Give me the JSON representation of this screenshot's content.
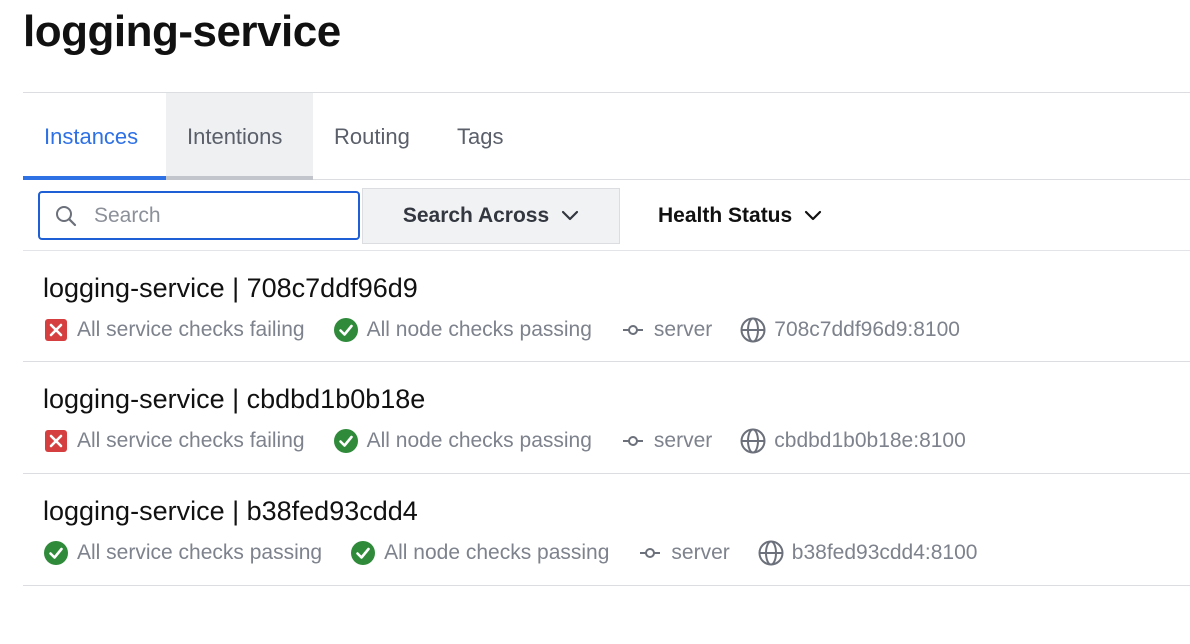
{
  "page": {
    "title": "logging-service"
  },
  "tabs": [
    {
      "label": "Instances",
      "state": "active"
    },
    {
      "label": "Intentions",
      "state": "hover"
    },
    {
      "label": "Routing",
      "state": "normal"
    },
    {
      "label": "Tags",
      "state": "normal"
    }
  ],
  "toolbar": {
    "search_placeholder": "Search",
    "search_value": "",
    "search_across_label": "Search Across",
    "health_status_label": "Health Status"
  },
  "colors": {
    "accent": "#2e71e5",
    "failing": "#d63f3f",
    "passing": "#2f8a3a",
    "muted_text": "#7d828c"
  },
  "instances": [
    {
      "title": "logging-service | 708c7ddf96d9",
      "service_check": {
        "status": "failing",
        "icon": "x-square-icon",
        "text": "All service checks failing"
      },
      "node_check": {
        "status": "passing",
        "icon": "check-circle-icon",
        "text": "All node checks passing"
      },
      "node": {
        "icon": "node-icon",
        "text": "server"
      },
      "address": {
        "icon": "globe-icon",
        "text": "708c7ddf96d9:8100"
      }
    },
    {
      "title": "logging-service | cbdbd1b0b18e",
      "service_check": {
        "status": "failing",
        "icon": "x-square-icon",
        "text": "All service checks failing"
      },
      "node_check": {
        "status": "passing",
        "icon": "check-circle-icon",
        "text": "All node checks passing"
      },
      "node": {
        "icon": "node-icon",
        "text": "server"
      },
      "address": {
        "icon": "globe-icon",
        "text": "cbdbd1b0b18e:8100"
      }
    },
    {
      "title": "logging-service | b38fed93cdd4",
      "service_check": {
        "status": "passing",
        "icon": "check-circle-icon",
        "text": "All service checks passing"
      },
      "node_check": {
        "status": "passing",
        "icon": "check-circle-icon",
        "text": "All node checks passing"
      },
      "node": {
        "icon": "node-icon",
        "text": "server"
      },
      "address": {
        "icon": "globe-icon",
        "text": "b38fed93cdd4:8100"
      }
    }
  ]
}
